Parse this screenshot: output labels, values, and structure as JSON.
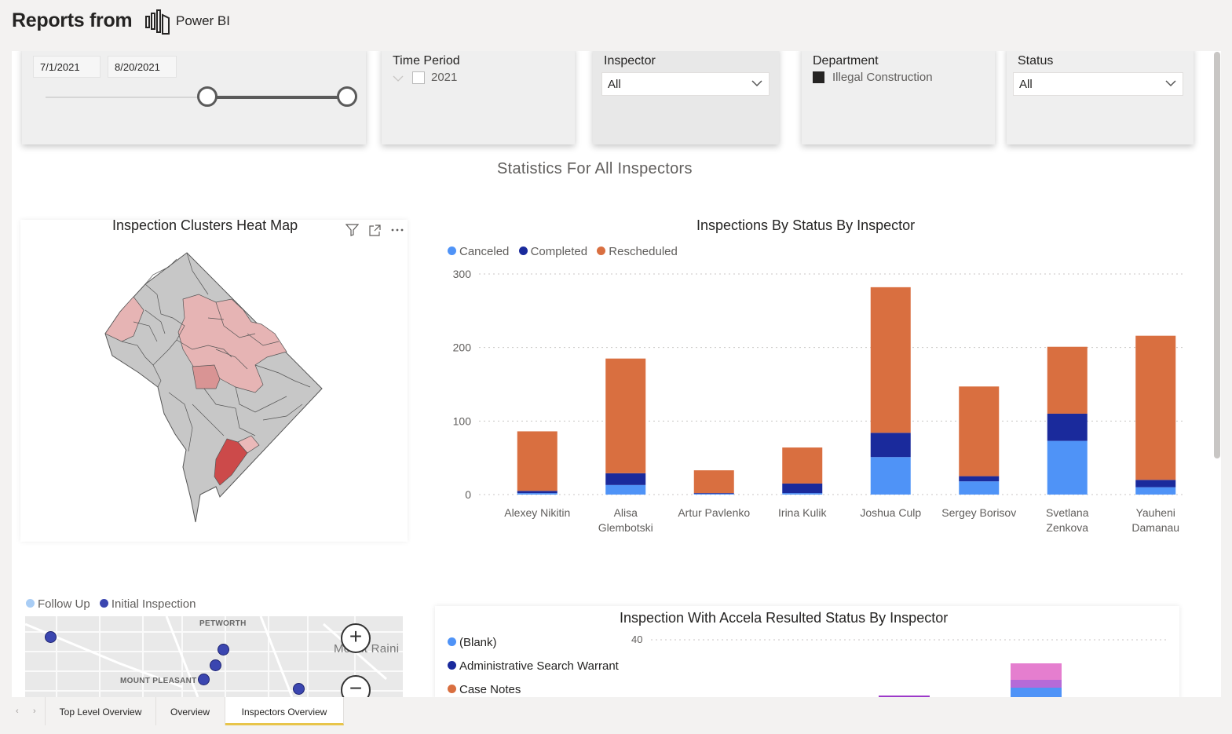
{
  "app": {
    "title": "Reports from",
    "product_name": "Power BI"
  },
  "slicers": {
    "date": {
      "start": "7/1/2021",
      "end": "8/20/2021",
      "range_fraction": [
        0.52,
        0.97
      ]
    },
    "time_period": {
      "title": "Time Period",
      "option": "2021",
      "checked": false
    },
    "inspector": {
      "title": "Inspector",
      "value": "All"
    },
    "department": {
      "title": "Department",
      "option": "Illegal Construction",
      "checked": true
    },
    "status": {
      "title": "Status",
      "value": "All"
    }
  },
  "section_title": "Statistics For All Inspectors",
  "heatmap": {
    "title": "Inspection Clusters Heat Map",
    "icons": [
      "filter-icon",
      "focus-mode-icon",
      "more-options-icon"
    ]
  },
  "chart_data": [
    {
      "type": "bar",
      "stacked": true,
      "title": "Inspections By Status By Inspector",
      "categories": [
        "Alexey Nikitin",
        "Alisa Glembotski",
        "Artur Pavlenko",
        "Irina Kulik",
        "Joshua Culp",
        "Sergey Borisov",
        "Svetlana Zenkova",
        "Yauheni Damanau"
      ],
      "category_lines": [
        [
          "Alexey Nikitin"
        ],
        [
          "Alisa",
          "Glembotski"
        ],
        [
          "Artur Pavlenko"
        ],
        [
          "Irina Kulik"
        ],
        [
          "Joshua Culp"
        ],
        [
          "Sergey Borisov"
        ],
        [
          "Svetlana",
          "Zenkova"
        ],
        [
          "Yauheni",
          "Damanau"
        ]
      ],
      "series": [
        {
          "name": "Canceled",
          "color": "#4f93f7",
          "values": [
            2,
            13,
            1,
            2,
            51,
            18,
            73,
            10
          ]
        },
        {
          "name": "Completed",
          "color": "#1a2a9c",
          "values": [
            3,
            16,
            1,
            13,
            33,
            7,
            37,
            10
          ]
        },
        {
          "name": "Rescheduled",
          "color": "#d96f40",
          "values": [
            81,
            156,
            31,
            49,
            198,
            122,
            91,
            196
          ]
        }
      ],
      "ylim": [
        0,
        300
      ],
      "yticks": [
        0,
        100,
        200,
        300
      ],
      "grid": true,
      "legend": "top-left"
    },
    {
      "type": "bar",
      "stacked": true,
      "title": "Inspection With Accela Resulted Status By Inspector",
      "series": [
        {
          "name": "(Blank)",
          "color": "#4f93f7"
        },
        {
          "name": "Administrative Search Warrant",
          "color": "#1a2a9c"
        },
        {
          "name": "Case Notes",
          "color": "#d96f40"
        }
      ],
      "yticks": [
        40
      ],
      "legend": "left"
    }
  ],
  "points_map": {
    "legend": [
      {
        "name": "Follow Up",
        "color": "#a9cdf5"
      },
      {
        "name": "Initial Inspection",
        "color": "#3b46b0"
      }
    ],
    "labels": [
      "PETWORTH",
      "MOUNT PLEASANT",
      "Mount Raini"
    ]
  },
  "tabs": [
    {
      "label": "Top Level Overview",
      "active": false
    },
    {
      "label": "Overview",
      "active": false
    },
    {
      "label": "Inspectors Overview",
      "active": true
    }
  ]
}
